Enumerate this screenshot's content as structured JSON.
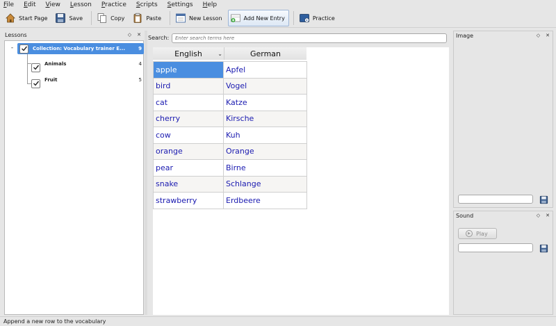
{
  "menubar": {
    "items": [
      "File",
      "Edit",
      "View",
      "Lesson",
      "Practice",
      "Scripts",
      "Settings",
      "Help"
    ]
  },
  "toolbar": {
    "start_page": "Start Page",
    "save": "Save",
    "copy": "Copy",
    "paste": "Paste",
    "new_lesson": "New Lesson",
    "add_new_entry": "Add New Entry",
    "practice": "Practice"
  },
  "lessons": {
    "title": "Lessons",
    "root": {
      "label": "Collection: Vocabulary trainer E...",
      "count": "9"
    },
    "children": [
      {
        "label": "Animals",
        "count": "4"
      },
      {
        "label": "Fruit",
        "count": "5"
      }
    ]
  },
  "search": {
    "label": "Search:",
    "placeholder": "Enter search terms here"
  },
  "table": {
    "columns": [
      "English",
      "German"
    ],
    "rows": [
      [
        "apple",
        "Apfel"
      ],
      [
        "bird",
        "Vogel"
      ],
      [
        "cat",
        "Katze"
      ],
      [
        "cherry",
        "Kirsche"
      ],
      [
        "cow",
        "Kuh"
      ],
      [
        "orange",
        "Orange"
      ],
      [
        "pear",
        "Birne"
      ],
      [
        "snake",
        "Schlange"
      ],
      [
        "strawberry",
        "Erdbeere"
      ]
    ]
  },
  "image_panel": {
    "title": "Image"
  },
  "sound_panel": {
    "title": "Sound",
    "play_label": "Play"
  },
  "statusbar": {
    "text": "Append a new row to the vocabulary"
  },
  "colors": {
    "selection": "#4a8ee0",
    "entry_text": "#1a1ab0"
  }
}
